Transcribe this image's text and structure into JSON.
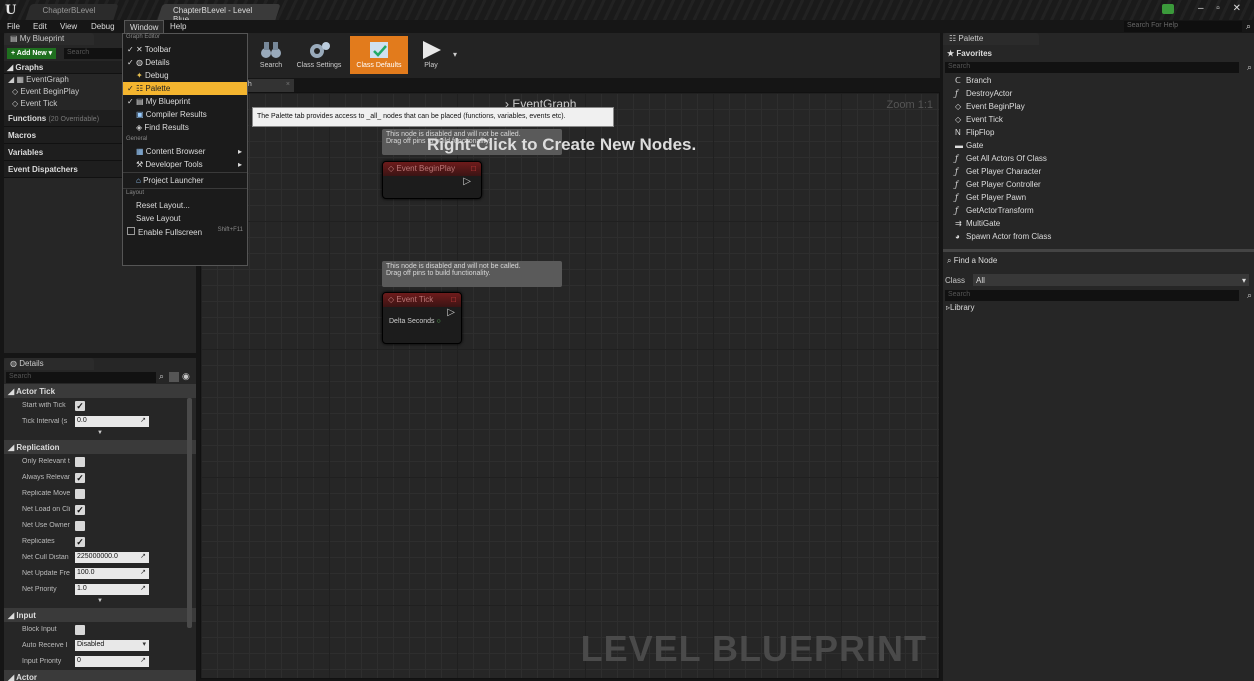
{
  "titlebar": {
    "tabs": [
      {
        "label": "ChapterBLevel"
      },
      {
        "label": "ChapterBLevel - Level Blue..."
      }
    ],
    "search_help_placeholder": "Search For Help"
  },
  "menubar": {
    "items": [
      "File",
      "Edit",
      "View",
      "Debug",
      "Window",
      "Help"
    ]
  },
  "left_panel": {
    "my_blueprint_tab": "My Blueprint",
    "add_new": "+ Add New ▾",
    "search_placeholder": "Search",
    "graphs_header": "Graphs",
    "event_graph": "EventGraph",
    "graph_items": [
      "Event BeginPlay",
      "Event Tick"
    ],
    "functions_header": "Functions",
    "functions_count": "(20 Overridable)",
    "macros_header": "Macros",
    "variables_header": "Variables",
    "dispatchers_header": "Event Dispatchers"
  },
  "details": {
    "tab": "Details",
    "search_placeholder": "Search",
    "groups": {
      "actor_tick": "Actor Tick",
      "replication": "Replication",
      "input": "Input",
      "actor": "Actor"
    },
    "actor_tick": {
      "start_with_tick": "Start with Tick",
      "tick_interval": "Tick Interval (s",
      "tick_interval_value": "0.0"
    },
    "replication": {
      "only_relevant": "Only Relevant t",
      "always_relevant": "Always Relevan",
      "replicate_move": "Replicate Move",
      "net_load": "Net Load on Cli",
      "net_use_owner": "Net Use Owner",
      "replicates": "Replicates",
      "net_cull": "Net Cull Distan",
      "net_cull_value": "225000000.0",
      "net_update": "Net Update Fre",
      "net_update_value": "100.0",
      "net_priority": "Net Priority",
      "net_priority_value": "1.0"
    },
    "input": {
      "block_input": "Block Input",
      "auto_receive": "Auto Receive I",
      "auto_receive_value": "Disabled",
      "input_priority": "Input Priority",
      "input_priority_value": "0"
    }
  },
  "toolbar": {
    "buttons": [
      "Search",
      "Class Settings",
      "Class Defaults",
      "Play"
    ]
  },
  "graph": {
    "tab_label": "ph",
    "breadcrumb": "EventGraph",
    "zoom": "Zoom 1:1",
    "hint": "Right-Click to Create New Nodes.",
    "comment1_line1": "This node is disabled and will not be called.",
    "comment1_line2": "Drag off pins to build functionality.",
    "node1_title": "Event BeginPlay",
    "comment2_line1": "This node is disabled and will not be called.",
    "comment2_line2": "Drag off pins to build functionality.",
    "node2_title": "Event Tick",
    "node2_pin": "Delta Seconds",
    "watermark": "LEVEL BLUEPRINT",
    "tooltip": "The Palette tab provides access to _all_ nodes that can be placed (functions, variables, events etc)."
  },
  "window_menu": {
    "header_graph_editor": "Graph Editor",
    "graph_items": [
      {
        "label": "Toolbar",
        "checked": true
      },
      {
        "label": "Details",
        "checked": true
      },
      {
        "label": "Debug",
        "checked": false
      },
      {
        "label": "Palette",
        "checked": true
      },
      {
        "label": "My Blueprint",
        "checked": true
      },
      {
        "label": "Compiler Results",
        "checked": false
      },
      {
        "label": "Find Results",
        "checked": false
      }
    ],
    "header_general": "General",
    "general_items": [
      "Content Browser",
      "Developer Tools"
    ],
    "project_launcher": "Project Launcher",
    "header_layout": "Layout",
    "layout_items": [
      "Reset Layout...",
      "Save Layout"
    ],
    "fullscreen": "Enable Fullscreen",
    "fullscreen_shortcut": "Shift+F11"
  },
  "palette": {
    "tab": "Palette",
    "favorites": "Favorites",
    "search_placeholder": "Search",
    "items": [
      {
        "label": "Branch",
        "icon": "branch-icon"
      },
      {
        "label": "DestroyActor",
        "icon": "function-icon"
      },
      {
        "label": "Event BeginPlay",
        "icon": "event-icon"
      },
      {
        "label": "Event Tick",
        "icon": "event-icon"
      },
      {
        "label": "FlipFlop",
        "icon": "flipflop-icon"
      },
      {
        "label": "Gate",
        "icon": "gate-icon"
      },
      {
        "label": "Get All Actors Of Class",
        "icon": "function-icon"
      },
      {
        "label": "Get Player Character",
        "icon": "function-icon"
      },
      {
        "label": "Get Player Controller",
        "icon": "function-icon"
      },
      {
        "label": "Get Player Pawn",
        "icon": "function-icon"
      },
      {
        "label": "GetActorTransform",
        "icon": "function-icon"
      },
      {
        "label": "MultiGate",
        "icon": "multigate-icon"
      },
      {
        "label": "Spawn Actor from Class",
        "icon": "spawn-icon"
      }
    ],
    "find_node": "Find a Node",
    "class_label": "Class",
    "class_value": "All",
    "library": "Library"
  },
  "colors": {
    "accent": "#e27b1c",
    "highlight": "#f4b52f",
    "event_node": "#6e1b1b"
  }
}
